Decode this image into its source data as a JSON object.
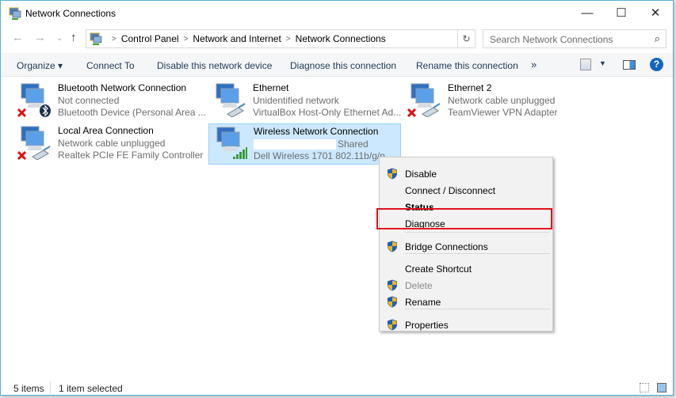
{
  "window": {
    "title": "Network Connections",
    "minimize": "—",
    "maximize": "☐",
    "close": "✕"
  },
  "address": {
    "crumbs": [
      "Control Panel",
      "Network and Internet",
      "Network Connections"
    ],
    "search_placeholder": "Search Network Connections"
  },
  "toolbar": {
    "organize": "Organize ▾",
    "connect_to": "Connect To",
    "disable": "Disable this network device",
    "diagnose": "Diagnose this connection",
    "rename": "Rename this connection",
    "more": "»"
  },
  "items": [
    {
      "name": "Bluetooth Network Connection",
      "status": "Not connected",
      "device": "Bluetooth Device (Personal Area ...",
      "badge": "bluetooth",
      "error": true
    },
    {
      "name": "Ethernet",
      "status": "Unidentified network",
      "device": "VirtualBox Host-Only Ethernet Ad...",
      "badge": "cable",
      "error": false
    },
    {
      "name": "Ethernet 2",
      "status": "Network cable unplugged",
      "device": "TeamViewer VPN Adapter",
      "badge": "cable",
      "error": true
    },
    {
      "name": "Local Area Connection",
      "status": "Network cable unplugged",
      "device": "Realtek PCIe FE Family Controller",
      "badge": "cable",
      "error": true
    },
    {
      "name": "Wireless Network Connection",
      "status": "Shared",
      "device": "Dell Wireless 1701 802.11b/g/n",
      "badge": "signal",
      "error": false,
      "selected": true
    }
  ],
  "menu": {
    "items": [
      {
        "label": "Disable",
        "shield": true
      },
      {
        "label": "Connect / Disconnect"
      },
      {
        "label": "Status",
        "bold": true
      },
      {
        "label": "Diagnose",
        "highlighted": true
      },
      {
        "label": "Bridge Connections",
        "shield": true
      },
      {
        "label": "Create Shortcut"
      },
      {
        "label": "Delete",
        "shield": true,
        "disabled": true
      },
      {
        "label": "Rename",
        "shield": true
      },
      {
        "label": "Properties",
        "shield": true
      }
    ]
  },
  "statusbar": {
    "count": "5 items",
    "selected": "1 item selected"
  },
  "colors": {
    "accent_border": "#55b3d6",
    "selection": "#cce8ff",
    "highlight_box": "#e0101c"
  }
}
